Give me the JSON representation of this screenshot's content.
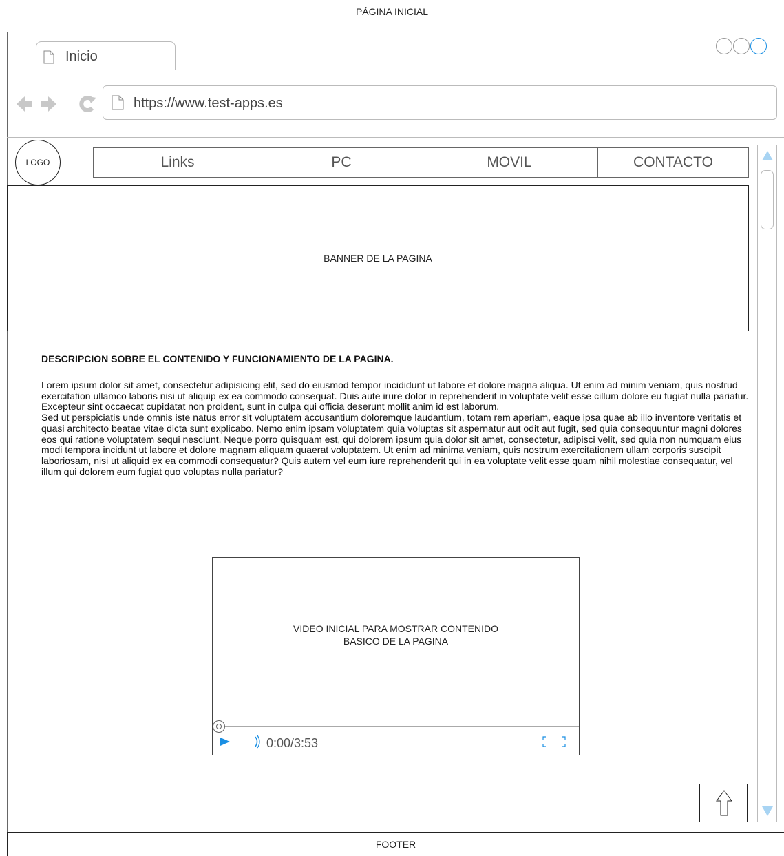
{
  "page_title": "PÁGINA INICIAL",
  "browser": {
    "tab_label": "Inicio",
    "url": "https://www.test-apps.es",
    "window_controls": [
      "minimize-icon",
      "maximize-icon",
      "close-icon"
    ],
    "nav_icons": [
      "back-arrow-icon",
      "forward-arrow-icon",
      "reload-icon"
    ]
  },
  "site": {
    "logo": "LOGO",
    "menu": [
      "Links",
      "PC",
      "MOVIL",
      "CONTACTO"
    ],
    "banner": "BANNER DE LA PAGINA",
    "description_title": "DESCRIPCION SOBRE EL CONTENIDO Y FUNCIONAMIENTO DE LA PAGINA.",
    "description_paragraphs": [
      "Lorem ipsum dolor sit amet, consectetur adipisicing elit, sed do eiusmod tempor incididunt ut labore et dolore magna aliqua. Ut enim ad minim veniam, quis nostrud exercitation ullamco laboris nisi ut aliquip ex ea commodo consequat. Duis aute irure dolor in reprehenderit in voluptate velit esse cillum dolore eu fugiat nulla pariatur. Excepteur sint occaecat cupidatat non proident, sunt in culpa qui officia deserunt mollit anim id est laborum.",
      "Sed ut perspiciatis unde omnis iste natus error sit voluptatem accusantium doloremque laudantium, totam rem aperiam, eaque ipsa quae ab illo inventore veritatis et quasi architecto beatae vitae dicta sunt explicabo. Nemo enim ipsam voluptatem quia voluptas sit aspernatur aut odit aut fugit, sed quia consequuntur magni dolores eos qui ratione voluptatem sequi nesciunt. Neque porro quisquam est, qui dolorem ipsum quia dolor sit amet, consectetur, adipisci velit, sed quia non numquam eius modi tempora incidunt ut labore et dolore magnam aliquam quaerat voluptatem. Ut enim ad minima veniam, quis nostrum exercitationem ullam corporis suscipit laboriosam, nisi ut aliquid ex ea commodi consequatur? Quis autem vel eum iure reprehenderit qui in ea voluptate velit esse quam nihil molestiae consequatur, vel illum qui dolorem eum fugiat quo voluptas nulla pariatur?"
    ],
    "video": {
      "caption_line1": "VIDEO INICIAL PARA MOSTRAR CONTENIDO",
      "caption_line2": "BASICO DE LA PAGINA",
      "time": "0:00/3:53",
      "progress": 0
    },
    "footer": "FOOTER"
  },
  "colors": {
    "accent": "#1a8fe3",
    "nav_gray": "#c8c8c8"
  }
}
